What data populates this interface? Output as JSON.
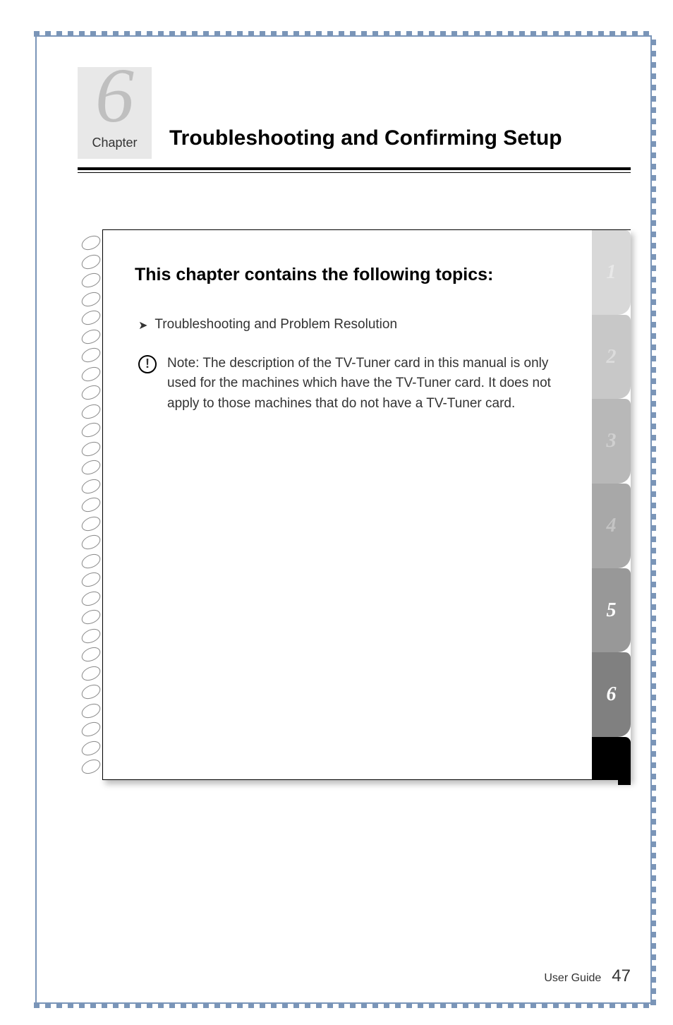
{
  "chapter": {
    "numeral": "6",
    "label": "Chapter",
    "title": "Troubleshooting and Confirming Setup"
  },
  "topics": {
    "heading": "This chapter contains the following topics:",
    "items": [
      "Troubleshooting and Problem Resolution"
    ]
  },
  "note": {
    "label": "Note:",
    "text": " The description of the TV-Tuner card in this manual is only used for the machines which have the TV-Tuner card. It does not apply to those machines that do not have a TV-Tuner card."
  },
  "tabs": [
    "1",
    "2",
    "3",
    "4",
    "5",
    "6"
  ],
  "footer": {
    "label": "User Guide",
    "page_number": "47"
  }
}
